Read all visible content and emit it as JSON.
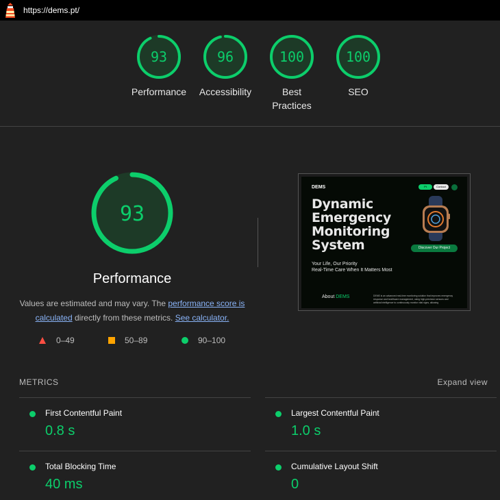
{
  "url_bar": {
    "url": "https://dems.pt/"
  },
  "colors": {
    "pass": "#0cce6b",
    "average": "#ffa400",
    "fail": "#ff4e42",
    "link": "#8ab4f8"
  },
  "summary": {
    "gauges": [
      {
        "score": "93",
        "label": "Performance",
        "fraction": 0.93
      },
      {
        "score": "96",
        "label": "Accessibility",
        "fraction": 0.96
      },
      {
        "score": "100",
        "label": "Best Practices",
        "fraction": 1.0
      },
      {
        "score": "100",
        "label": "SEO",
        "fraction": 1.0
      }
    ]
  },
  "performance": {
    "score": "93",
    "fraction": 0.93,
    "title": "Performance",
    "note_prefix": "Values are estimated and may vary. The ",
    "note_link1": "performance score is calculated",
    "note_middle": " directly from these metrics. ",
    "note_link2": "See calculator."
  },
  "legend": [
    {
      "range": "0–49",
      "icon": "fail-triangle-icon"
    },
    {
      "range": "50–89",
      "icon": "average-square-icon"
    },
    {
      "range": "90–100",
      "icon": "pass-circle-icon"
    }
  ],
  "thumbnail": {
    "brand": "DEMS",
    "nav1": "Pt",
    "nav2": "Contact",
    "headline_lines": [
      "Dynamic",
      "Emergency",
      "Monitoring",
      "System"
    ],
    "sub_line1": "Your Life, Our Priority",
    "sub_line2": "Real-Time Care When It Matters Most",
    "cta": "Discover Our Project",
    "about_prefix": "About ",
    "about_brand": "DEMS",
    "paragraph": "DEMS is an advanced real-time monitoring solution that improves emergency response and healthcare management, using high-precision sensors and artificial intelligence to continuously monitor vital signs, allowing"
  },
  "metrics": {
    "title": "METRICS",
    "expand": "Expand view",
    "items": [
      {
        "name": "First Contentful Paint",
        "value": "0.8 s"
      },
      {
        "name": "Largest Contentful Paint",
        "value": "1.0 s"
      },
      {
        "name": "Total Blocking Time",
        "value": "40 ms"
      },
      {
        "name": "Cumulative Layout Shift",
        "value": "0"
      }
    ]
  }
}
